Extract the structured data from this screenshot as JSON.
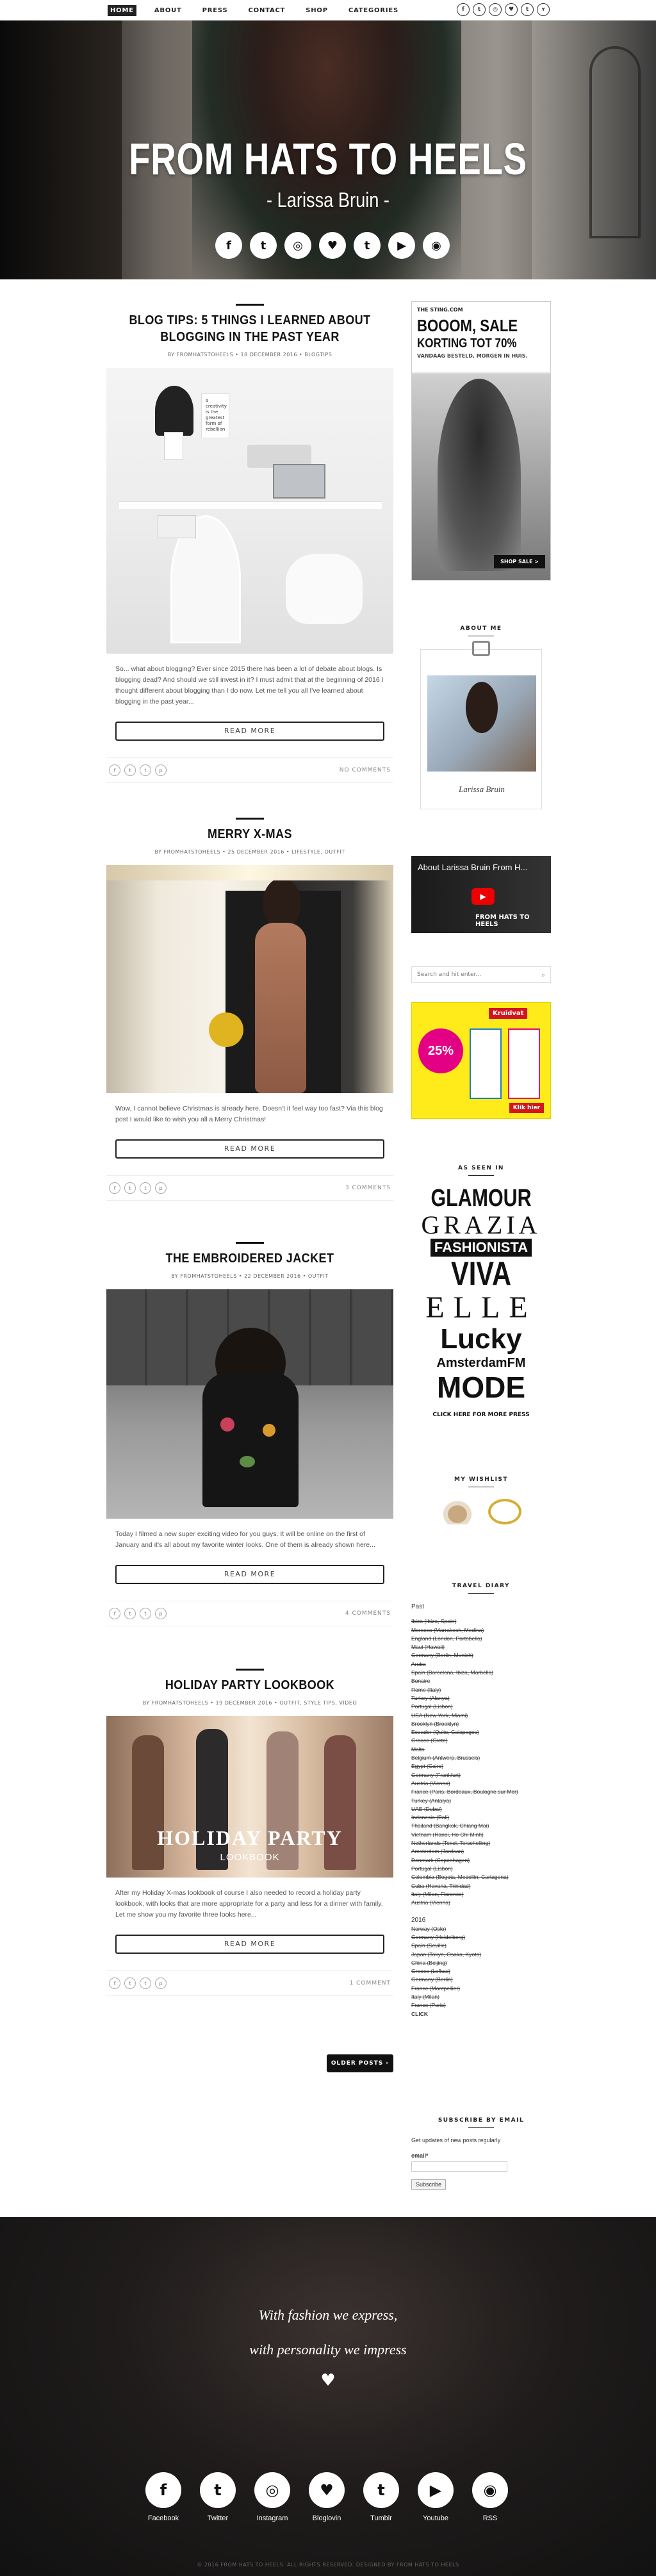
{
  "nav": {
    "items": [
      "HOME",
      "ABOUT",
      "PRESS",
      "CONTACT",
      "SHOP",
      "CATEGORIES"
    ],
    "social": [
      "f",
      "t",
      "◎",
      "♥",
      "t",
      "ʏ"
    ]
  },
  "hero": {
    "title": "FROM HATS TO HEELS",
    "subtitle": "- Larissa Bruin -",
    "icons": [
      "f",
      "t",
      "◎",
      "♥",
      "t",
      "▶",
      "◉"
    ]
  },
  "posts": [
    {
      "title": "BLOG TIPS: 5 THINGS I LEARNED ABOUT BLOGGING IN THE PAST YEAR",
      "meta": "BY FROMHATSTOHEELS  •  18 DECEMBER 2016  •  BLOGTIPS",
      "excerpt": "So... what about blogging? Ever since 2015 there has been a lot of debate about blogs. Is blogging dead? And should we still invest in it? I must admit that at the beginning of 2016 I thought different about blogging than I do now. Let me tell you all I've learned about blogging in the past year...",
      "readmore": "READ MORE",
      "comments": "NO COMMENTS",
      "img_text": "a creativity is the greatest form of rebellion"
    },
    {
      "title": "MERRY X-MAS",
      "meta": "BY FROMHATSTOHEELS  •  25 DECEMBER 2016  •  LIFESTYLE, OUTFIT",
      "excerpt": "Wow, I cannot believe Christmas is already here. Doesn't it feel way too fast? Via this blog post I would like to wish you all a Merry Christmas!",
      "readmore": "READ MORE",
      "comments": "3 COMMENTS"
    },
    {
      "title": "THE EMBROIDERED JACKET",
      "meta": "BY FROMHATSTOHEELS  •  22 DECEMBER 2016  •  OUTFIT",
      "excerpt": "Today I filmed a new super exciting video for you guys. It will be online on the first of January and it's all about my favorite winter looks. One of them is already shown here...",
      "readmore": "READ MORE",
      "comments": "4 COMMENTS"
    },
    {
      "title": "HOLIDAY PARTY LOOKBOOK",
      "meta": "BY FROMHATSTOHEELS  •  19 DECEMBER 2016  •  OUTFIT, STYLE TIPS, VIDEO",
      "excerpt": "After my Holiday X-mas lookbook of course I also needed to record a holiday party lookbook, with looks that are more appropriate for a party and less for a dinner with family. Let me show you my favorite three looks here...",
      "readmore": "READ MORE",
      "comments": "1 COMMENT",
      "img_title": "HOLIDAY PARTY",
      "img_sub": "LOOKBOOK"
    }
  ],
  "older_posts": "OLDER POSTS",
  "sidebar": {
    "ad1": {
      "brand": "THE STING.COM",
      "headline": "BOOOM, SALE",
      "sub": "KORTING TOT 70%",
      "sub2": "VANDAAG BESTELD, MORGEN IN HUIS.",
      "cta": "SHOP SALE >"
    },
    "about": {
      "title": "ABOUT ME",
      "signature": "Larissa Bruin"
    },
    "video": {
      "title": "About Larissa Bruin From H...",
      "caption": "FROM HATS TO HEELS"
    },
    "search_placeholder": "Search and hit enter...",
    "ad2": {
      "brand": "Kruidvat",
      "deal": "25%",
      "cta": "Klik hier"
    },
    "seen_in": {
      "title": "AS SEEN IN",
      "logos": [
        "GLAMOUR",
        "GRAZIA",
        "FASHIONISTA",
        "VIVA",
        "ELLE",
        "Lucky",
        "AmsterdamFM",
        "MODE"
      ],
      "link": "CLICK HERE FOR MORE PRESS"
    },
    "wishlist": {
      "title": "MY WISHLIST"
    },
    "diary": {
      "title": "TRAVEL DIARY",
      "past": "Past",
      "entries": [
        "Ibiza (Ibiza, Spain)",
        "Morocco (Marrakesh, Medina)",
        "England (London, Portobello)",
        "Maui (Hawaii)",
        "Germany (Berlin, Munich)",
        "Aruba",
        "Spain (Barcelona, Ibiza, Marbella)",
        "Bonaire",
        "Rome (Italy)",
        "Turkey (Alanya)",
        "Portugal (Lisbon)",
        "USA (New York, Miami)",
        "Brooklyn (Brooklyn)",
        "Ecuador (Quito, Galapagos)",
        "Greece (Crete)",
        "Malta",
        "Belgium (Antwerp, Brussels)",
        "Egypt (Cairo)",
        "Germany (Frankfurt)",
        "Austria (Vienna)",
        "France (Paris, Bordeaux, Boulogne sur Mer)",
        "Turkey (Antalya)",
        "UAE (Dubai)",
        "Indonesia (Bali)",
        "Thailand (Bangkok, Chiang Mai)",
        "Vietnam (Hanoi, Ho Chi Minh)",
        "Netherlands (Texel, Terschelling)",
        "Amsterdam (Jordaan)",
        "Denmark (Copenhagen)",
        "Portugal (Lisbon)",
        "Colombia (Bogota, Medellin, Cartagena)",
        "Cuba (Havana, Trinidad)",
        "Italy (Milan, Florence)",
        "Austria (Vienna)"
      ],
      "year": "2016",
      "entries2": [
        "Norway (Oslo)",
        "Germany (Heidelberg)",
        "Spain (Seville)",
        "Japan (Tokyo, Osaka, Kyoto)",
        "China (Beijing)",
        "Greece (Lefkas)",
        "Germany (Berlin)",
        "France (Montpellier)",
        "Italy (Milan)",
        "France (Paris)"
      ],
      "click": "CLICK"
    },
    "subscribe": {
      "title": "SUBSCRIBE BY EMAIL",
      "desc": "Get updates of new posts regularly",
      "label": "email*",
      "button": "Subscribe"
    }
  },
  "footer": {
    "quote1": "With fashion we express,",
    "quote2": "with personality we impress",
    "links": [
      {
        "icon": "f",
        "label": "Facebook"
      },
      {
        "icon": "t",
        "label": "Twitter"
      },
      {
        "icon": "◎",
        "label": "Instagram"
      },
      {
        "icon": "♥",
        "label": "Bloglovin"
      },
      {
        "icon": "t",
        "label": "Tumblr"
      },
      {
        "icon": "▶",
        "label": "Youtube"
      },
      {
        "icon": "◉",
        "label": "RSS"
      }
    ],
    "copyright": "© 2016 FROM HATS TO HEELS. ALL RIGHTS RESERVED. DESIGNED BY FROM HATS TO HEELS"
  }
}
